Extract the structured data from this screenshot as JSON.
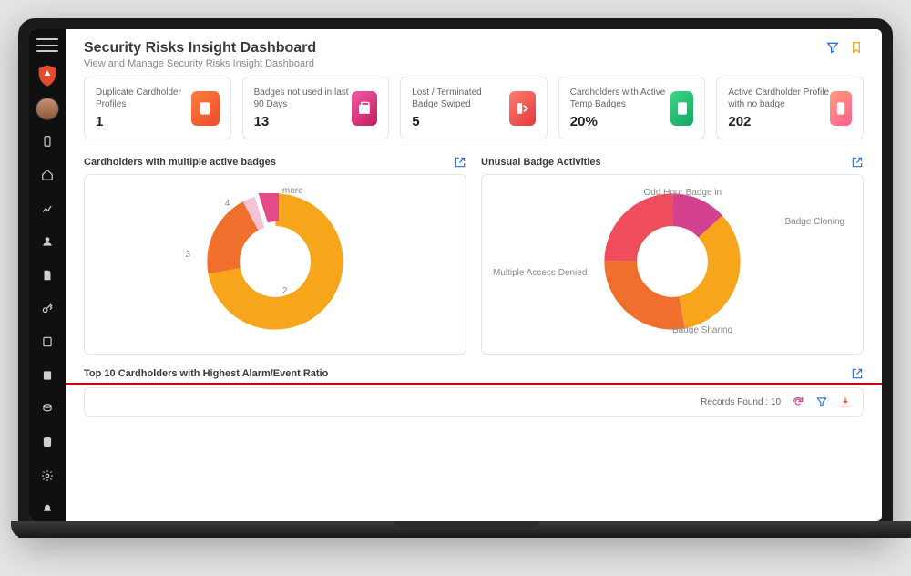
{
  "header": {
    "title": "Security Risks Insight Dashboard",
    "subtitle": "View and Manage Security Risks Insight Dashboard"
  },
  "stats": [
    {
      "label": "Duplicate Cardholder Profiles",
      "value": "1",
      "iconBg": "linear-gradient(135deg,#f87e3f,#f04a2a)"
    },
    {
      "label": "Badges not used in last 90 Days",
      "value": "13",
      "iconBg": "linear-gradient(135deg,#f25aa3,#c11b62)"
    },
    {
      "label": "Lost / Terminated Badge Swiped",
      "value": "5",
      "iconBg": "linear-gradient(135deg,#ff7a6e,#e23b3b)"
    },
    {
      "label": "Cardholders with Active Temp Badges",
      "value": "20%",
      "iconBg": "linear-gradient(135deg,#3bd68a,#12a75f)"
    },
    {
      "label": "Active Cardholder Profile with no badge",
      "value": "202",
      "iconBg": "linear-gradient(135deg,#ff9a7a,#ff5f8f)"
    }
  ],
  "chart1": {
    "title": "Cardholders with multiple active badges",
    "labels": {
      "more": "more",
      "a": "4",
      "b": "3",
      "c": "2"
    }
  },
  "chart2": {
    "title": "Unusual Badge Activities",
    "labels": {
      "oddHour": "Odd Hour Badge in",
      "cloning": "Badge Cloning",
      "sharing": "Badge Sharing",
      "denied": "Multiple Access Denied"
    }
  },
  "section3": {
    "title": "Top 10 Cardholders with Highest Alarm/Event Ratio",
    "recordsLabel": "Records Found : 10"
  },
  "chart_data": [
    {
      "type": "pie",
      "title": "Cardholders with multiple active badges",
      "series": [
        {
          "name": "2",
          "value": 72,
          "color": "#f7a61b"
        },
        {
          "name": "3",
          "value": 20,
          "color": "#f06f2c"
        },
        {
          "name": "4",
          "value": 3,
          "color": "#f5c3d6"
        },
        {
          "name": "more",
          "value": 5,
          "color": "#e34a8a"
        }
      ],
      "donut": true
    },
    {
      "type": "pie",
      "title": "Unusual Badge Activities",
      "series": [
        {
          "name": "Odd Hour Badge in",
          "value": 13,
          "color": "#d4418e"
        },
        {
          "name": "Badge Cloning",
          "value": 34,
          "color": "#f7a61b"
        },
        {
          "name": "Badge Sharing",
          "value": 28,
          "color": "#f06f2c"
        },
        {
          "name": "Multiple Access Denied",
          "value": 25,
          "color": "#ef4d5c"
        }
      ],
      "donut": true
    }
  ],
  "colors": {
    "accentBlue": "#2a6fd6",
    "accentOrange": "#f5a623",
    "redline": "#d40000"
  }
}
